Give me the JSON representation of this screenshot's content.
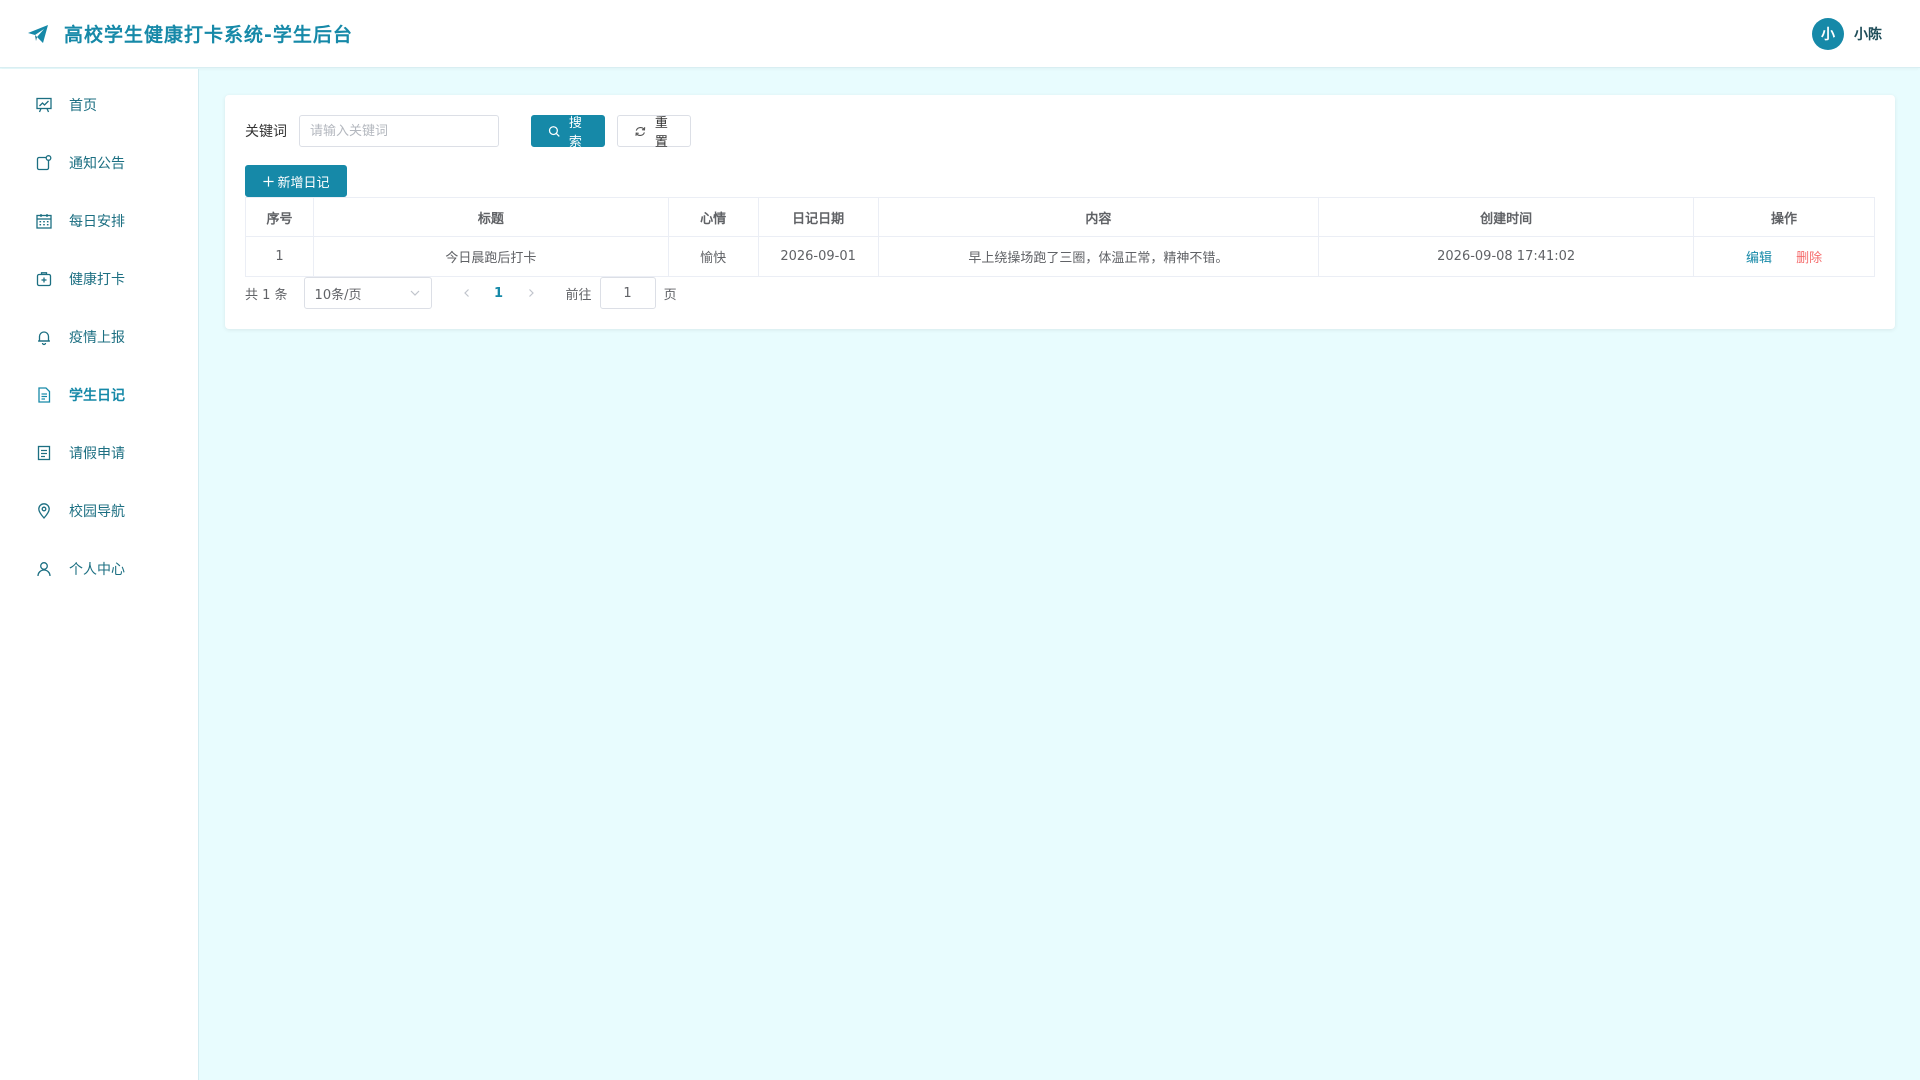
{
  "header": {
    "title": "高校学生健康打卡系统-学生后台",
    "avatar_text": "小",
    "username": "小陈"
  },
  "sidebar": {
    "items": [
      {
        "label": "首页",
        "icon": "dashboard-icon"
      },
      {
        "label": "通知公告",
        "icon": "notice-icon"
      },
      {
        "label": "每日安排",
        "icon": "calendar-icon"
      },
      {
        "label": "健康打卡",
        "icon": "medical-kit-icon"
      },
      {
        "label": "疫情上报",
        "icon": "bell-icon"
      },
      {
        "label": "学生日记",
        "icon": "document-icon"
      },
      {
        "label": "请假申请",
        "icon": "list-icon"
      },
      {
        "label": "校园导航",
        "icon": "location-icon"
      },
      {
        "label": "个人中心",
        "icon": "user-icon"
      }
    ],
    "active_index": 5
  },
  "search": {
    "label": "关键词",
    "placeholder": "请输入关键词",
    "value": "",
    "search_label": "搜索",
    "reset_label": "重置"
  },
  "toolbar": {
    "add_label": "新增日记"
  },
  "table": {
    "headers": [
      "序号",
      "标题",
      "心情",
      "日记日期",
      "内容",
      "创建时间",
      "操作"
    ],
    "rows": [
      {
        "index": "1",
        "title": "今日晨跑后打卡",
        "mood": "愉快",
        "date": "2026-09-01",
        "content": "早上绕操场跑了三圈，体温正常，精神不错。",
        "created": "2026-09-08 17:41:02",
        "edit_label": "编辑",
        "delete_label": "删除"
      }
    ]
  },
  "pagination": {
    "total_text": "共 1 条",
    "page_size": "10条/页",
    "current_page": "1",
    "goto_label": "前往",
    "goto_value": "1",
    "page_suffix": "页"
  },
  "colors": {
    "primary": "#1689a8",
    "background": "#e8fcfe",
    "danger": "#f56c6c"
  }
}
